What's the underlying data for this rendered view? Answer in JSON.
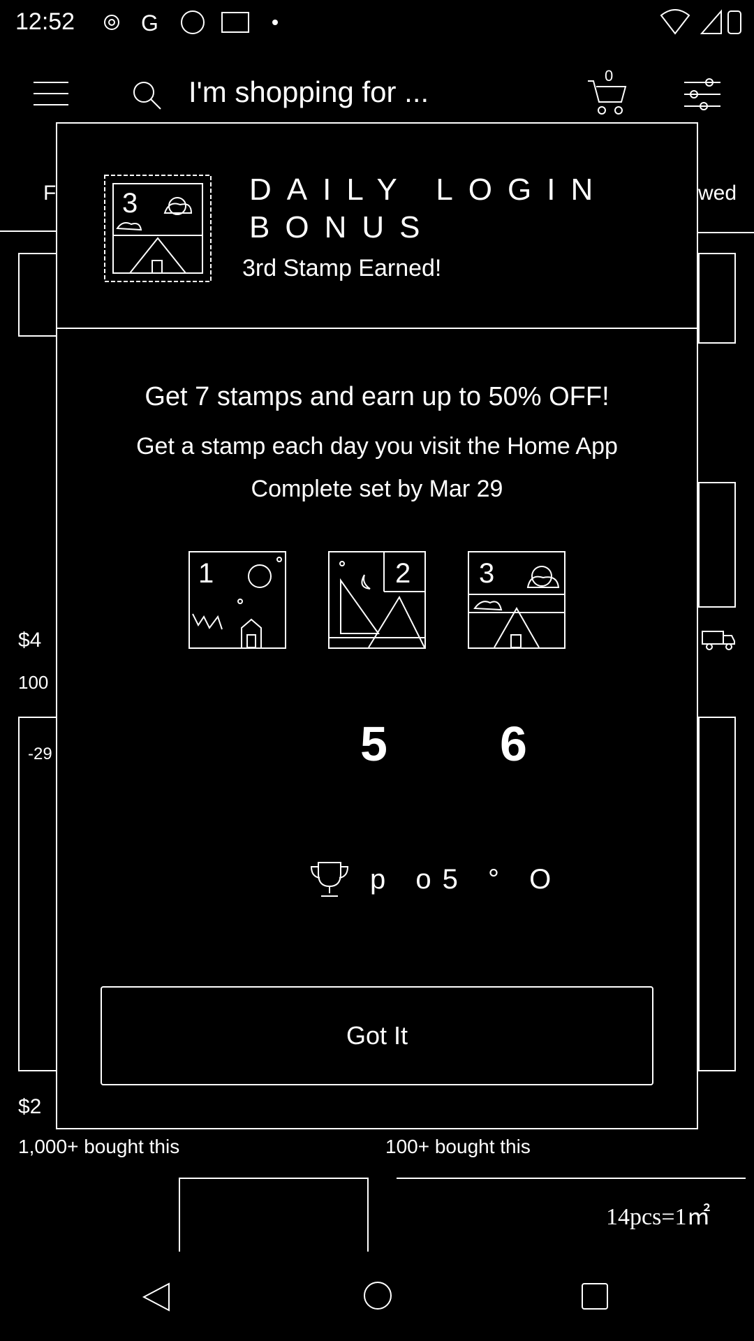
{
  "status_bar": {
    "time": "12:52"
  },
  "app_bar": {
    "search_placeholder": "I'm shopping for ...",
    "cart_count": "0"
  },
  "background": {
    "left_tab_fragment": "F",
    "right_tab_fragment": "wed",
    "price_left_1": "$4",
    "count_left_1": "100",
    "discount_left": "-29",
    "price_left_2": "$2",
    "bought_left": "1,000+ bought this",
    "bought_right": "100+ bought this",
    "product_label": "14pcs=1㎡"
  },
  "modal": {
    "title": "DAILY LOGIN BONUS",
    "subtitle": "3rd Stamp Earned!",
    "header_stamp_number": "3",
    "headline": "Get 7 stamps and earn up to 50% OFF!",
    "description_line1": "Get a stamp each day you visit the Home App",
    "description_line2": "Complete set by Mar 29",
    "stamps": [
      {
        "number": "1"
      },
      {
        "number": "2"
      },
      {
        "number": "3"
      }
    ],
    "pending_days": [
      "5",
      "6"
    ],
    "reward_text": "p o5 ° O",
    "button_label": "Got It"
  }
}
